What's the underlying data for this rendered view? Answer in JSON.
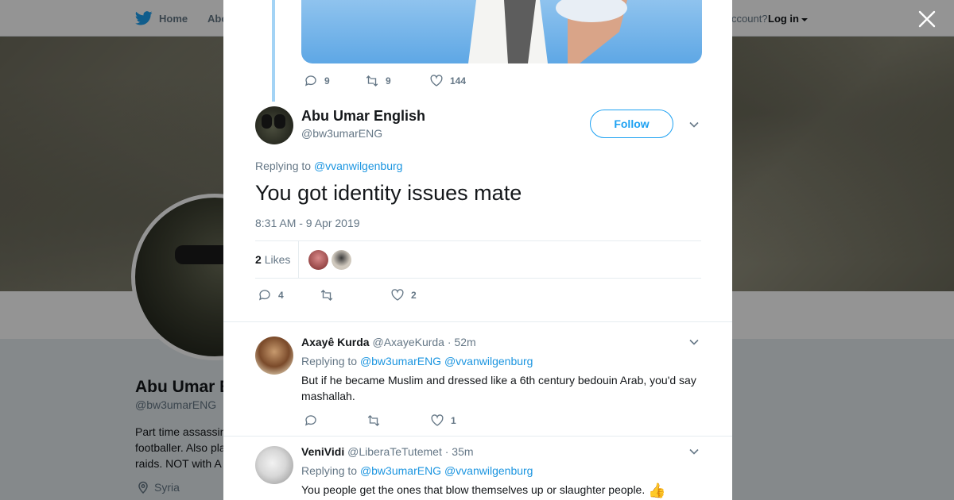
{
  "background": {
    "nav": {
      "home": "Home",
      "about_partial": "Abo",
      "account_partial": "ccount?",
      "login": "Log in"
    },
    "profile": {
      "name_partial": "Abu Umar E",
      "handle": "@bw3umarENG",
      "bio_lines": [
        "Part time assassin",
        "footballer. Also pla",
        "raids. NOT with A"
      ],
      "location": "Syria"
    }
  },
  "modal": {
    "previous_tweet": {
      "replies": "9",
      "retweets": "9",
      "likes": "144"
    },
    "tweet": {
      "author_name": "Abu Umar English",
      "author_handle": "@bw3umarENG",
      "follow_label": "Follow",
      "replying_prefix": "Replying to",
      "replying_to": "@vvanwilgenburg",
      "text": "You got identity issues mate",
      "timestamp": "8:31 AM - 9 Apr 2019",
      "like_count": "2",
      "like_label": "Likes",
      "actions": {
        "replies": "4",
        "retweets": "",
        "likes": "2"
      }
    },
    "replies": [
      {
        "name": "Axayê Kurda",
        "handle": "@AxayeKurda",
        "time": "· 52m",
        "replying_prefix": "Replying to",
        "replying_to_1": "@bw3umarENG",
        "replying_to_2": "@vvanwilgenburg",
        "text": "But if he became Muslim and dressed like a 6th century bedouin Arab, you'd say mashallah.",
        "replies": "",
        "retweets": "",
        "likes": "1"
      },
      {
        "name": "VeniVidi",
        "handle": "@LiberaTeTutemet",
        "time": "· 35m",
        "replying_prefix": "Replying to",
        "replying_to_1": "@bw3umarENG",
        "replying_to_2": "@vvanwilgenburg",
        "text": "You people get the ones that blow themselves up or slaughter people.",
        "emoji": "👍"
      }
    ]
  },
  "colors": {
    "link": "#1b95e0",
    "accent": "#1da1f2",
    "muted": "#657786",
    "text": "#14171a"
  }
}
